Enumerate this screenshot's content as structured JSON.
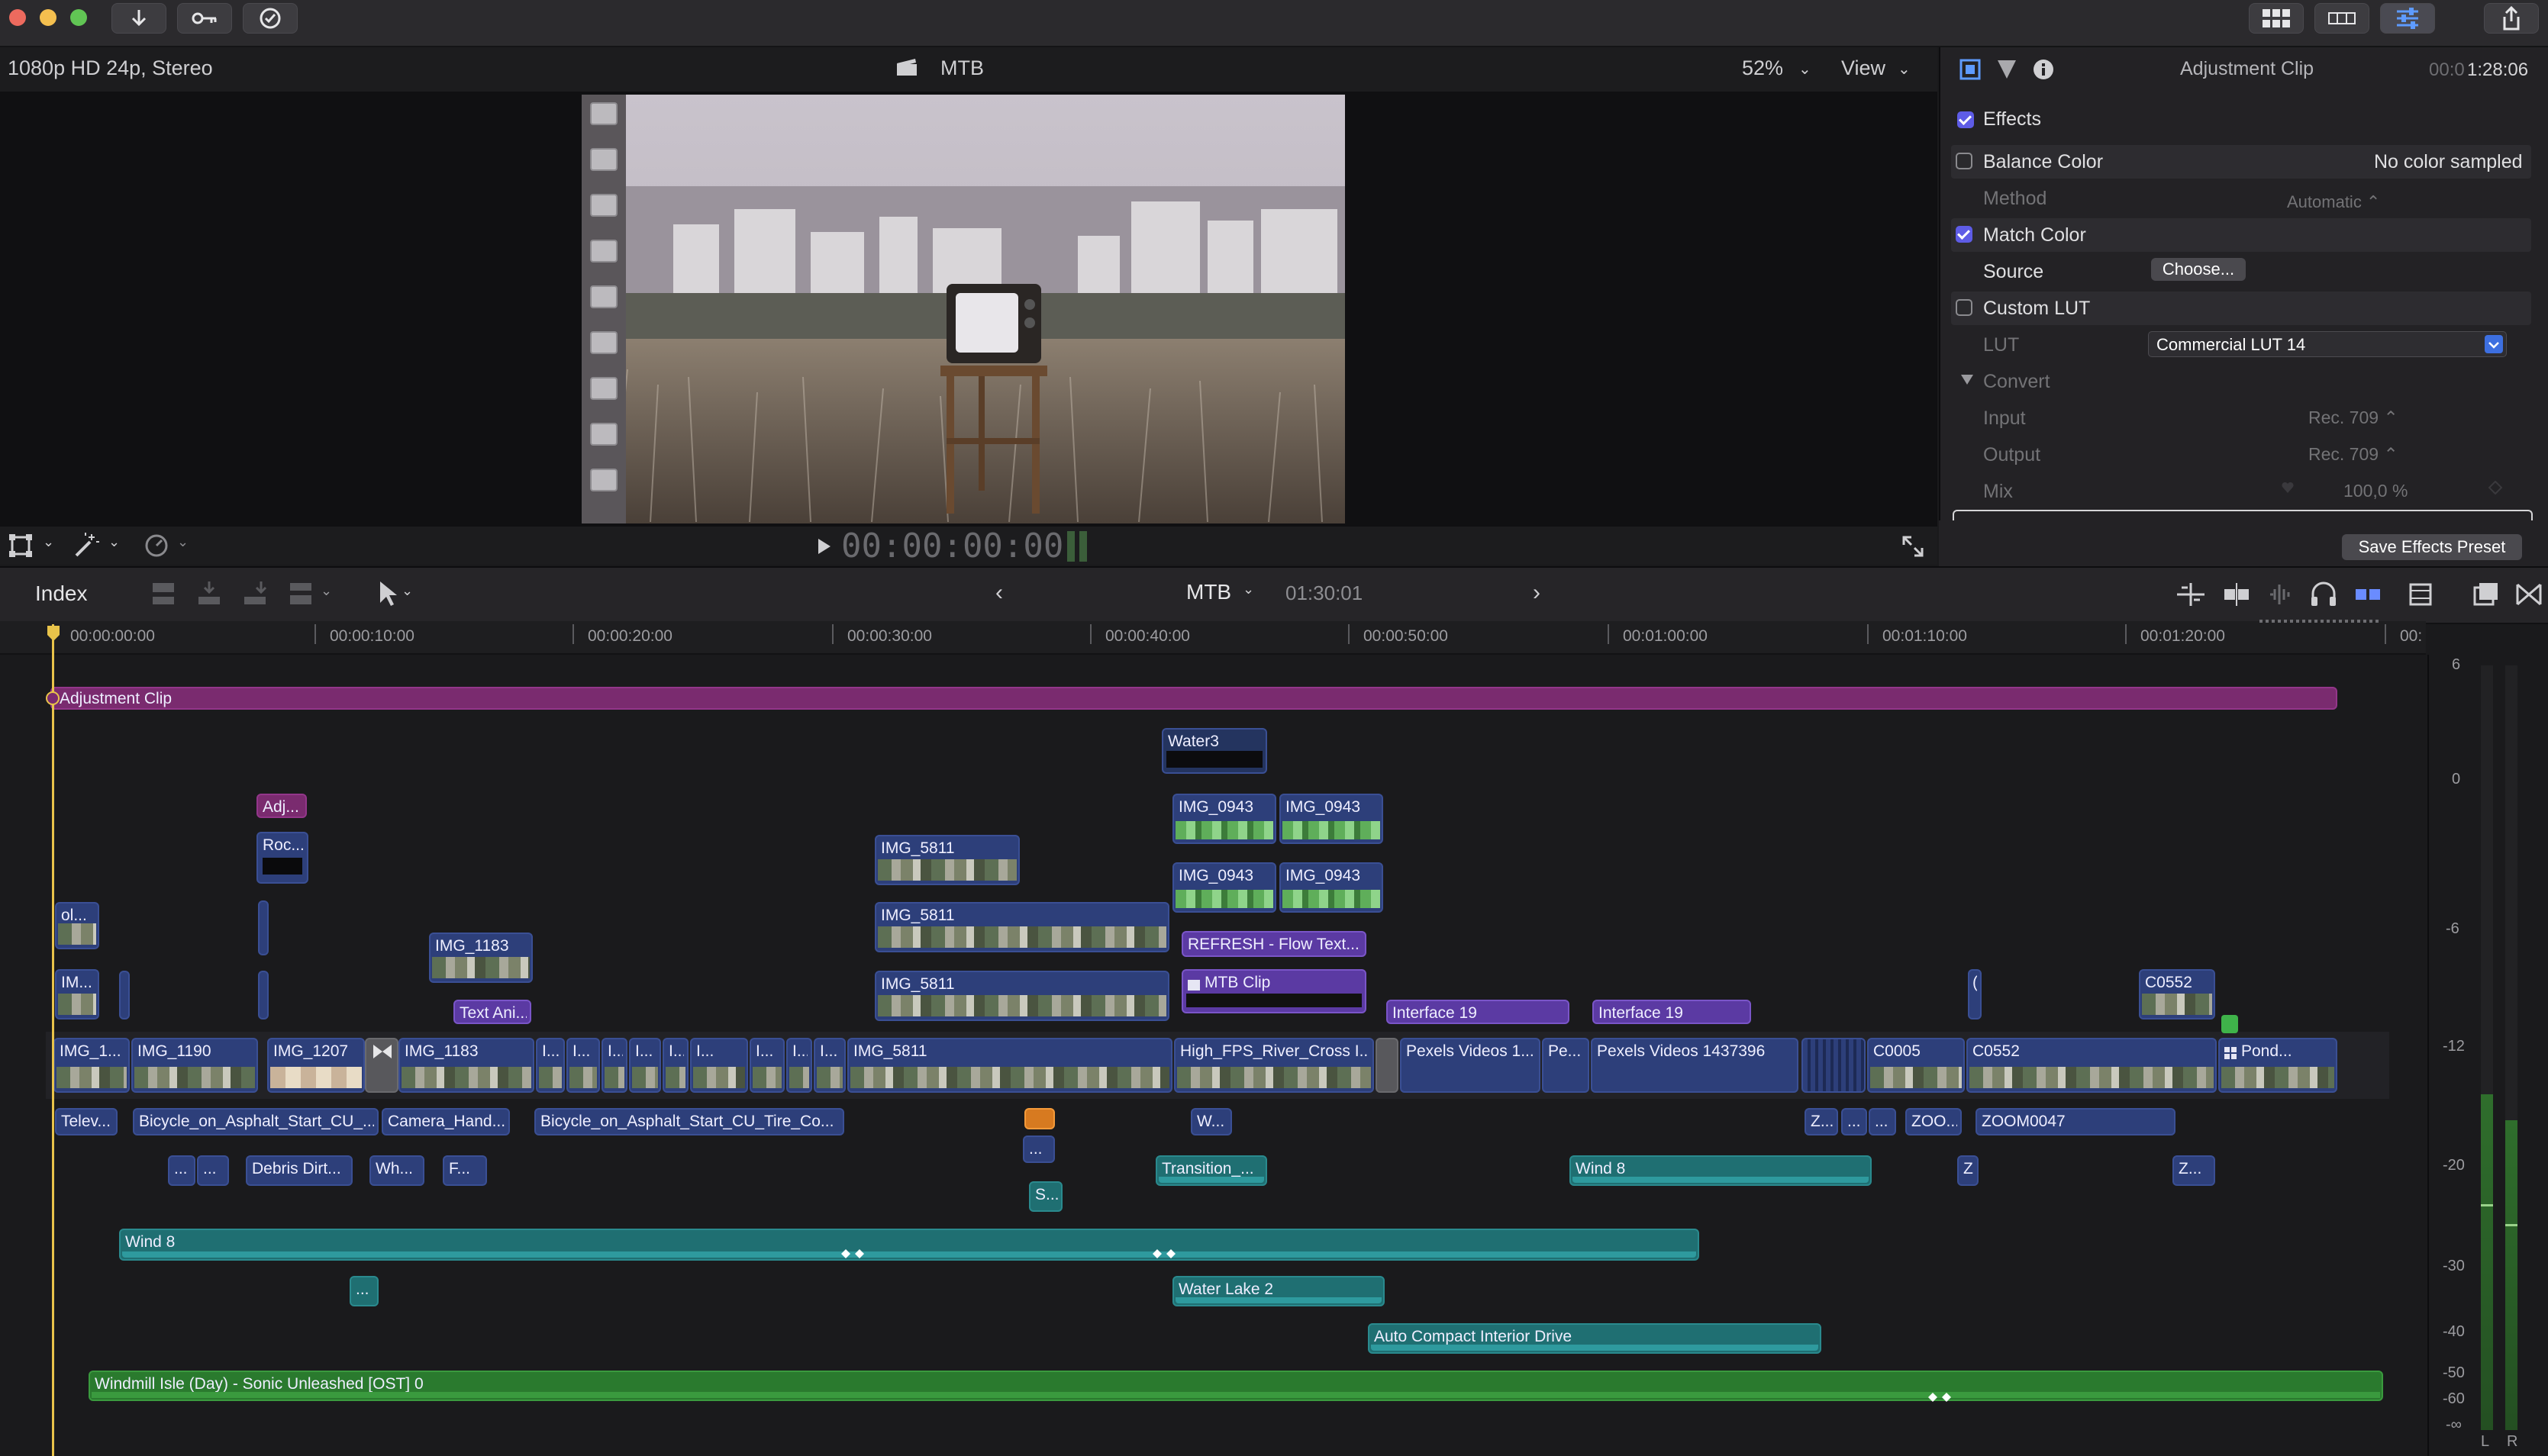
{
  "viewer": {
    "format": "1080p HD 24p, Stereo",
    "project_name": "MTB",
    "zoom": "52%",
    "view_menu": "View",
    "timecode": "00:00:00:00"
  },
  "inspector": {
    "title": "Adjustment Clip",
    "duration_dim": "00:0",
    "duration": "1:28:06",
    "effects_label": "Effects",
    "balance_color": {
      "label": "Balance Color",
      "status": "No color sampled",
      "method_label": "Method",
      "method_value": "Automatic ⌃"
    },
    "match_color": {
      "label": "Match Color",
      "source_label": "Source",
      "choose_button": "Choose..."
    },
    "custom_lut": {
      "label": "Custom LUT",
      "lut_label": "LUT",
      "lut_value": "Commercial LUT 14",
      "convert_label": "Convert",
      "input_label": "Input",
      "input_value": "Rec. 709 ⌃",
      "output_label": "Output",
      "output_value": "Rec. 709 ⌃",
      "mix_label": "Mix",
      "mix_value": "100,0  %"
    },
    "save_preset": "Save Effects Preset"
  },
  "timeline": {
    "index_label": "Index",
    "project": "MTB",
    "duration": "01:30:01",
    "ruler": [
      "00:00:00:00",
      "00:00:10:00",
      "00:00:20:00",
      "00:00:30:00",
      "00:00:40:00",
      "00:00:50:00",
      "00:01:00:00",
      "00:01:10:00",
      "00:01:20:00",
      "00:"
    ]
  },
  "clips": {
    "adjustment": "Adjustment Clip",
    "water3": "Water3",
    "adj_small": "Adj...",
    "roc": "Roc...",
    "ol": "ol...",
    "im": "IM...",
    "img_1183_top": "IMG_1183",
    "text_ani": "Text Ani...",
    "img_5811_a": "IMG_5811",
    "img_5811_b": "IMG_5811",
    "img_5811_c": "IMG_5811",
    "img_0943_a": "IMG_0943",
    "img_0943_b": "IMG_0943",
    "img_0943_c": "IMG_0943",
    "img_0943_d": "IMG_0943",
    "refresh": "REFRESH - Flow Text...",
    "mtb_clip": "MTB Clip",
    "interface_a": "Interface 19",
    "interface_b": "Interface 19",
    "c0552_top": "C0552",
    "paren": "(",
    "s_img_1": "IMG_1...",
    "s_img_1190": "IMG_1190",
    "s_img_1207": "IMG_1207",
    "s_img_1183": "IMG_1183",
    "s_i": "I...",
    "s_img_5811": "IMG_5811",
    "s_high_fps": "High_FPS_River_Cross I...",
    "s_pexels_1": "Pexels Videos 1...",
    "s_pe": "Pe...",
    "s_pexels_2": "Pexels Videos 1437396",
    "s_c0005": "C0005",
    "s_c0552": "C0552",
    "s_pond": "Pond...",
    "a_telev": "Telev...",
    "a_bicycle_1": "Bicycle_on_Asphalt_Start_CU_...",
    "a_camera": "Camera_Hand...",
    "a_bicycle_2": "Bicycle_on_Asphalt_Start_CU_Tire_Co...",
    "a_w": "W...",
    "a_z": "Z...",
    "a_dots": "...",
    "a_zoo": "ZOO...",
    "a_zoom0047": "ZOOM0047",
    "a_debris": "Debris Dirt...",
    "a_wh": "Wh...",
    "a_f": "F...",
    "a_transition": "Transition_...",
    "a_wind8_short": "Wind 8",
    "a_z2": "Z",
    "a_z3": "Z...",
    "a_s": "S...",
    "a_wind8_long": "Wind 8",
    "a_water_lake": "Water Lake 2",
    "a_auto": "Auto Compact Interior Drive",
    "music": "Windmill Isle (Day) - Sonic Unleashed [OST] 0"
  },
  "meters": {
    "scale": [
      "6",
      "0",
      "-6",
      "-12",
      "-20",
      "-30",
      "-40",
      "-50",
      "-60",
      "-∞"
    ],
    "left": "L",
    "right": "R"
  },
  "colors": {
    "video_clip": "#2d3f7a",
    "title_clip": "#5b3aa3",
    "generator_clip": "#7a2b6f",
    "audio_clip": "#1f6f72",
    "music_clip": "#2a7a2e",
    "playhead": "#e8c34a",
    "accent": "#5e5ce6"
  }
}
